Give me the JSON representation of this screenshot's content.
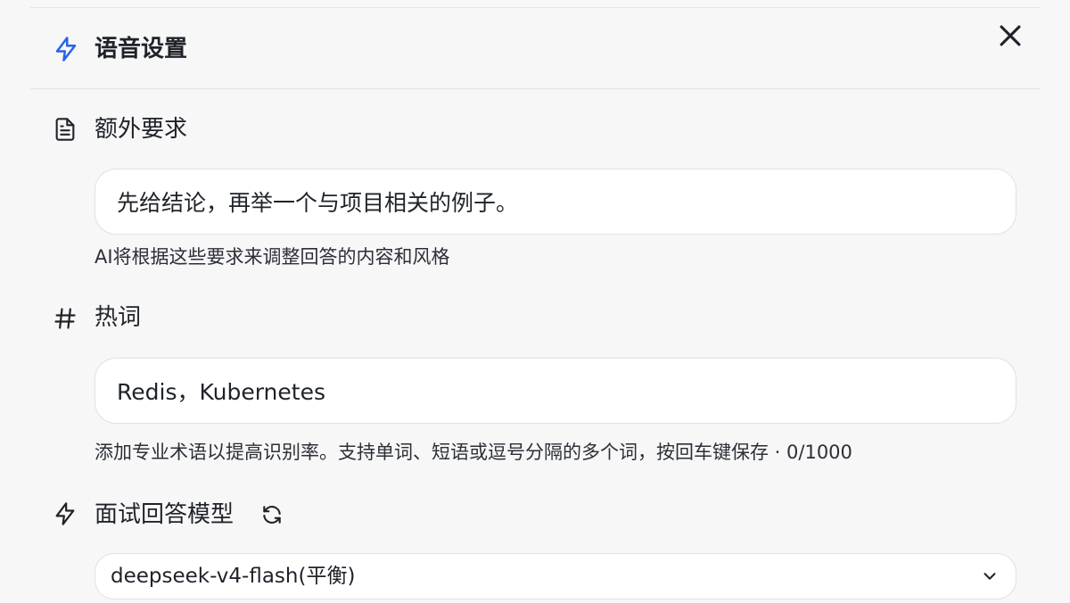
{
  "dialog": {
    "title": "语音设置",
    "title_icon": "lightning-icon",
    "close_icon": "close-icon",
    "accent_color": "#2563eb"
  },
  "extra_requirements": {
    "label": "额外要求",
    "icon": "document-icon",
    "value": "先给结论，再举一个与项目相关的例子。",
    "hint": "AI将根据这些要求来调整回答的内容和风格"
  },
  "hotwords": {
    "label": "热词",
    "icon": "hash-icon",
    "value": "Redis，Kubernetes",
    "hint": "添加专业术语以提高识别率。支持单词、短语或逗号分隔的多个词，按回车键保存 · 0/1000"
  },
  "model": {
    "label": "面试回答模型",
    "icon": "lightning-icon",
    "refresh_icon": "refresh-icon",
    "selected": "deepseek-v4-flash(平衡)",
    "dropdown_icon": "chevron-down-icon"
  }
}
